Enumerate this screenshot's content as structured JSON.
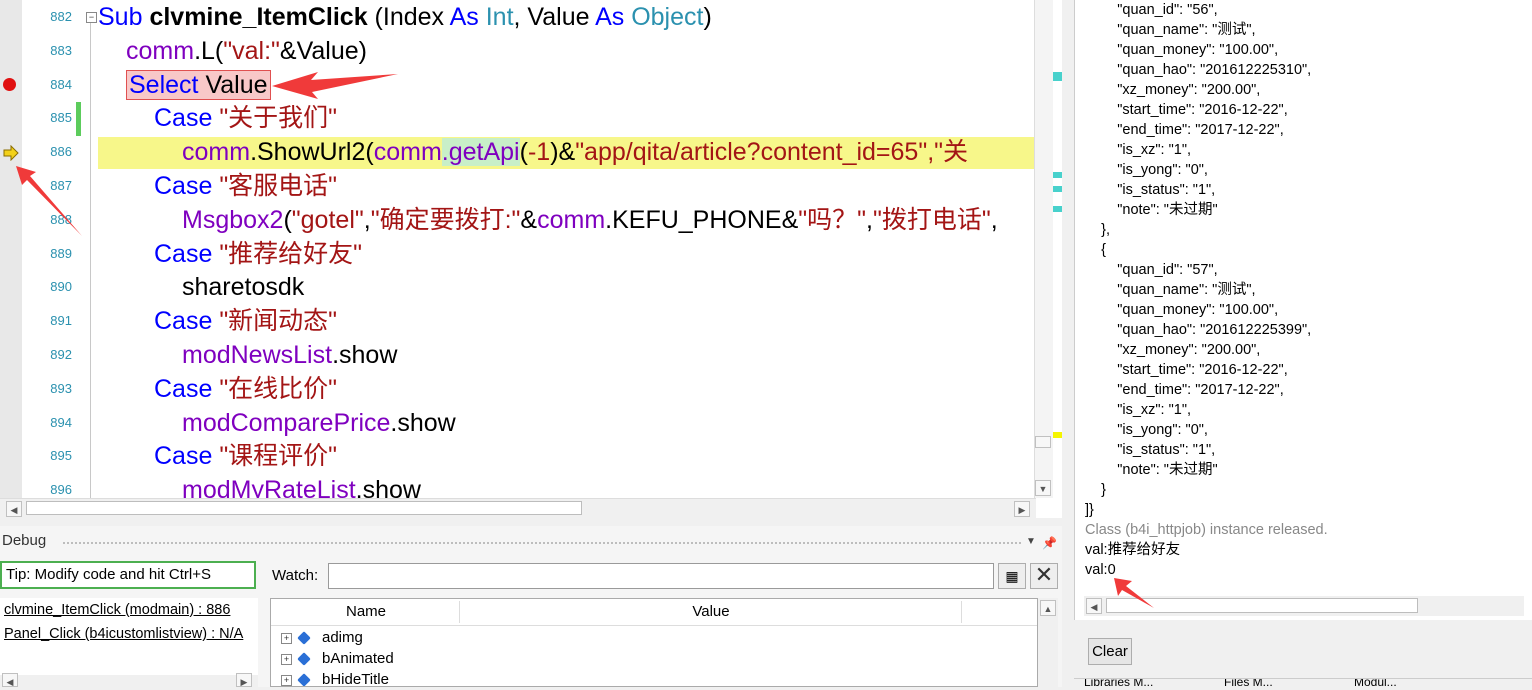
{
  "editor": {
    "line_numbers": [
      "882",
      "883",
      "884",
      "885",
      "886",
      "887",
      "888",
      "889",
      "890",
      "891",
      "892",
      "893",
      "894",
      "895",
      "896"
    ],
    "lines": [
      {
        "indent": 0,
        "parts": [
          {
            "t": "Sub ",
            "c": "kw"
          },
          {
            "t": "clvmine_ItemClick",
            "c": "bold"
          },
          {
            "t": " (Index ",
            "c": ""
          },
          {
            "t": "As ",
            "c": "kw"
          },
          {
            "t": "Int",
            "c": "obj"
          },
          {
            "t": ", Value ",
            "c": ""
          },
          {
            "t": "As ",
            "c": "kw"
          },
          {
            "t": "Object",
            "c": "obj"
          },
          {
            "t": ")",
            "c": ""
          }
        ]
      },
      {
        "indent": 1,
        "parts": [
          {
            "t": "comm",
            "c": "cls"
          },
          {
            "t": ".L(",
            "c": ""
          },
          {
            "t": "\"val:\"",
            "c": "str"
          },
          {
            "t": "&Value)",
            "c": ""
          }
        ]
      },
      {
        "indent": 1,
        "parts": [
          {
            "t": "Select ",
            "c": "kw"
          },
          {
            "t": "Value",
            "c": ""
          }
        ],
        "highlight": "select"
      },
      {
        "indent": 2,
        "parts": [
          {
            "t": "Case ",
            "c": "kw"
          },
          {
            "t": "\"关于我们\"",
            "c": "str"
          }
        ]
      },
      {
        "indent": 3,
        "parts": [
          {
            "t": "comm",
            "c": "cls"
          },
          {
            "t": ".ShowUrl2(",
            "c": ""
          },
          {
            "t": "comm",
            "c": "cls"
          },
          {
            "t": ".getApi",
            "c": "hlget"
          },
          {
            "t": "(",
            "c": ""
          },
          {
            "t": "-1",
            "c": "num"
          },
          {
            "t": ")&",
            "c": ""
          },
          {
            "t": "\"app/qita/article?content_id=65\"",
            "c": "str"
          },
          {
            "t": ",\"关",
            "c": "str"
          }
        ],
        "exec": true
      },
      {
        "indent": 2,
        "parts": [
          {
            "t": "Case ",
            "c": "kw"
          },
          {
            "t": "\"客服电话\"",
            "c": "str"
          }
        ]
      },
      {
        "indent": 3,
        "parts": [
          {
            "t": "Msgbox2",
            "c": "cls"
          },
          {
            "t": "(",
            "c": ""
          },
          {
            "t": "\"gotel\"",
            "c": "str"
          },
          {
            "t": ",",
            "c": ""
          },
          {
            "t": "\"确定要拨打:\"",
            "c": "str"
          },
          {
            "t": "&",
            "c": ""
          },
          {
            "t": "comm",
            "c": "cls"
          },
          {
            "t": ".KEFU_PHONE&",
            "c": ""
          },
          {
            "t": "\"吗？\"",
            "c": "str"
          },
          {
            "t": ",",
            "c": ""
          },
          {
            "t": "\"拨打电话\"",
            "c": "str"
          },
          {
            "t": ",",
            "c": ""
          }
        ]
      },
      {
        "indent": 2,
        "parts": [
          {
            "t": "Case ",
            "c": "kw"
          },
          {
            "t": "\"推荐给好友\"",
            "c": "str"
          }
        ]
      },
      {
        "indent": 3,
        "parts": [
          {
            "t": "sharetosdk",
            "c": ""
          }
        ]
      },
      {
        "indent": 2,
        "parts": [
          {
            "t": "Case ",
            "c": "kw"
          },
          {
            "t": "\"新闻动态\"",
            "c": "str"
          }
        ]
      },
      {
        "indent": 3,
        "parts": [
          {
            "t": "modNewsList",
            "c": "cls"
          },
          {
            "t": ".show",
            "c": ""
          }
        ]
      },
      {
        "indent": 2,
        "parts": [
          {
            "t": "Case ",
            "c": "kw"
          },
          {
            "t": "\"在线比价\"",
            "c": "str"
          }
        ]
      },
      {
        "indent": 3,
        "parts": [
          {
            "t": "modComparePrice",
            "c": "cls"
          },
          {
            "t": ".show",
            "c": ""
          }
        ]
      },
      {
        "indent": 2,
        "parts": [
          {
            "t": "Case ",
            "c": "kw"
          },
          {
            "t": "\"课程评价\"",
            "c": "str"
          }
        ]
      },
      {
        "indent": 3,
        "parts": [
          {
            "t": "modMyRateList",
            "c": "cls"
          },
          {
            "t": ".show",
            "c": ""
          }
        ]
      }
    ]
  },
  "log": {
    "lines": [
      {
        "t": "        \"quan_id\": \"56\","
      },
      {
        "t": "        \"quan_name\": \"测试\","
      },
      {
        "t": "        \"quan_money\": \"100.00\","
      },
      {
        "t": "        \"quan_hao\": \"201612225310\","
      },
      {
        "t": "        \"xz_money\": \"200.00\","
      },
      {
        "t": "        \"start_time\": \"2016-12-22\","
      },
      {
        "t": "        \"end_time\": \"2017-12-22\","
      },
      {
        "t": "        \"is_xz\": \"1\","
      },
      {
        "t": "        \"is_yong\": \"0\","
      },
      {
        "t": "        \"is_status\": \"1\","
      },
      {
        "t": "        \"note\": \"未过期\""
      },
      {
        "t": "    },"
      },
      {
        "t": "    {"
      },
      {
        "t": "        \"quan_id\": \"57\","
      },
      {
        "t": "        \"quan_name\": \"测试\","
      },
      {
        "t": "        \"quan_money\": \"100.00\","
      },
      {
        "t": "        \"quan_hao\": \"201612225399\","
      },
      {
        "t": "        \"xz_money\": \"200.00\","
      },
      {
        "t": "        \"start_time\": \"2016-12-22\","
      },
      {
        "t": "        \"end_time\": \"2017-12-22\","
      },
      {
        "t": "        \"is_xz\": \"1\","
      },
      {
        "t": "        \"is_yong\": \"0\","
      },
      {
        "t": "        \"is_status\": \"1\","
      },
      {
        "t": "        \"note\": \"未过期\""
      },
      {
        "t": "    }"
      },
      {
        "t": "]}"
      },
      {
        "t": "Class (b4i_httpjob) instance released.",
        "gray": true
      },
      {
        "t": "val:推荐给好友"
      },
      {
        "t": "val:0"
      }
    ],
    "clear_label": "Clear",
    "bottom_tabs": [
      "Libraries M...",
      "Files M...",
      "Modul..."
    ]
  },
  "debug": {
    "title": "Debug",
    "tip": "Tip: Modify code and hit Ctrl+S",
    "stack": [
      "clvmine_ItemClick (modmain) : 886",
      "Panel_Click (b4icustomlistview) : N/A"
    ],
    "watch_label": "Watch:",
    "watch_value": "",
    "columns": {
      "name": "Name",
      "value": "Value"
    },
    "rows": [
      "adimg",
      "bAnimated",
      "bHideTitle"
    ]
  },
  "colors": {
    "keyword": "#0000ff",
    "string": "#a31515",
    "member": "#7f00bf",
    "exec_line": "#f7f78a",
    "breakpoint": "#e01010",
    "annotation_arrow": "#f03a3a"
  }
}
